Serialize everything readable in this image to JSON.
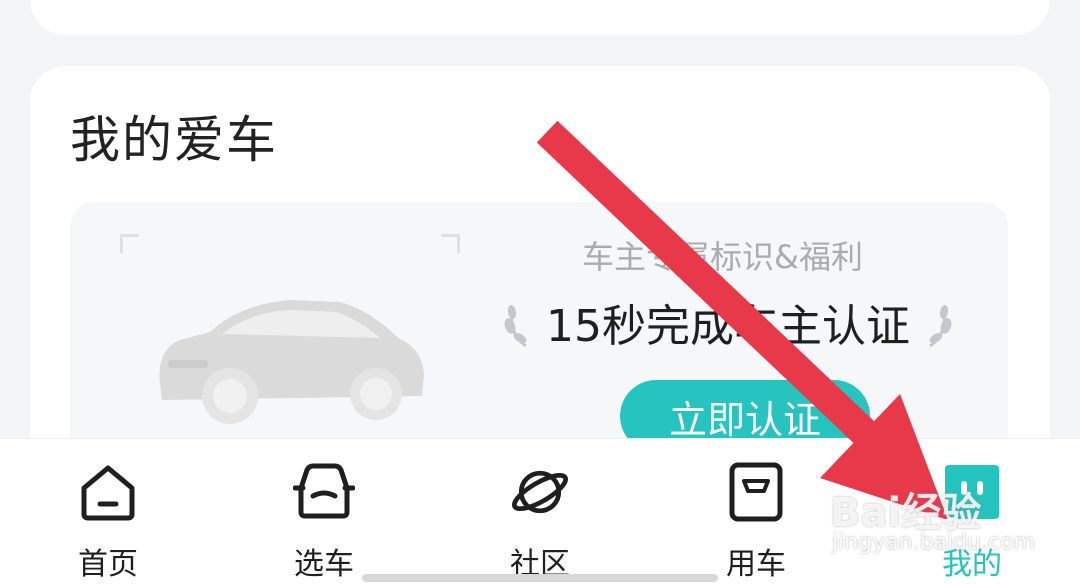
{
  "section": {
    "title": "我的爱车",
    "promo_subtitle": "车主专属标识&福利",
    "promo_main": "15秒完成车主认证",
    "verify_button": "立即认证"
  },
  "tabbar": {
    "tabs": [
      {
        "label": "首页",
        "icon": "home-icon"
      },
      {
        "label": "选车",
        "icon": "car-select-icon"
      },
      {
        "label": "社区",
        "icon": "planet-icon"
      },
      {
        "label": "用车",
        "icon": "car-use-icon"
      },
      {
        "label": "我的",
        "icon": "profile-icon",
        "active": true
      }
    ]
  },
  "watermark": {
    "brand": "Bai经验",
    "url": "jingyan.baidu.com"
  },
  "colors": {
    "accent": "#25c3bd",
    "arrow": "#e8394a",
    "background": "#f4f5f7"
  }
}
